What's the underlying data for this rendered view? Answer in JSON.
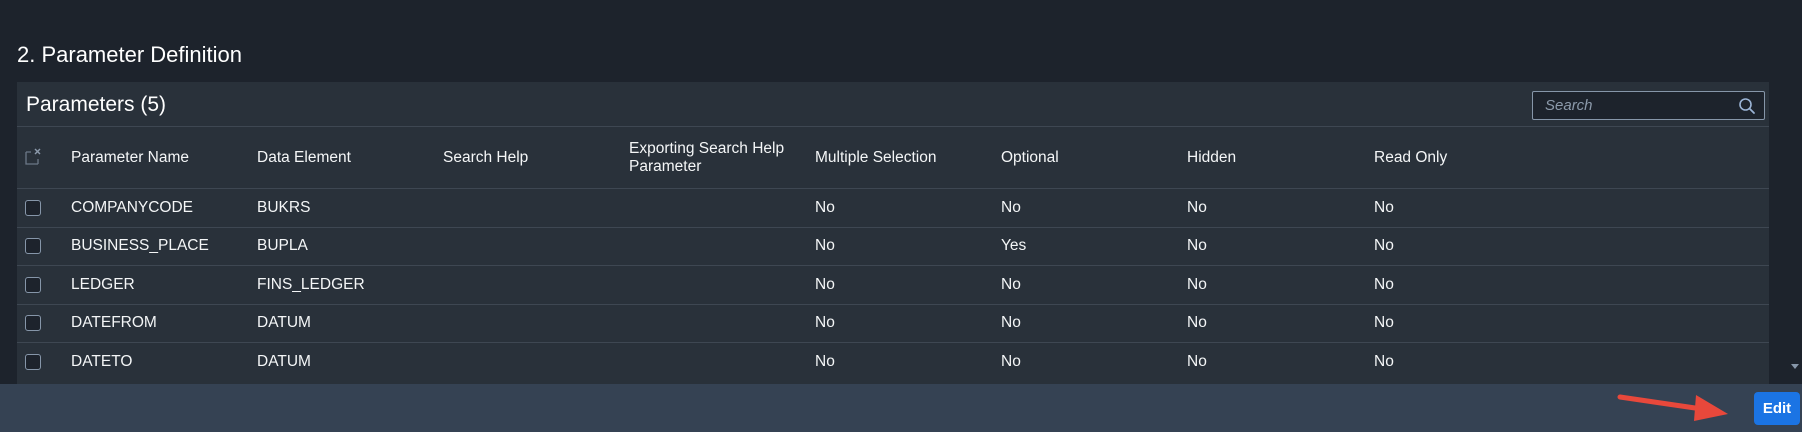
{
  "section": {
    "title": "2. Parameter Definition"
  },
  "panel": {
    "title": "Parameters (5)",
    "search": {
      "placeholder": "Search",
      "value": ""
    }
  },
  "table": {
    "columns": [
      "Parameter Name",
      "Data Element",
      "Search Help",
      "Exporting Search Help Parameter",
      "Multiple Selection",
      "Optional",
      "Hidden",
      "Read Only"
    ],
    "rows": [
      [
        "COMPANYCODE",
        "BUKRS",
        "",
        "",
        "No",
        "No",
        "No",
        "No"
      ],
      [
        "BUSINESS_PLACE",
        "BUPLA",
        "",
        "",
        "No",
        "Yes",
        "No",
        "No"
      ],
      [
        "LEDGER",
        "FINS_LEDGER",
        "",
        "",
        "No",
        "No",
        "No",
        "No"
      ],
      [
        "DATEFROM",
        "DATUM",
        "",
        "",
        "No",
        "No",
        "No",
        "No"
      ],
      [
        "DATETO",
        "DATUM",
        "",
        "",
        "No",
        "No",
        "No",
        "No"
      ]
    ]
  },
  "footer": {
    "edit_label": "Edit"
  },
  "colors": {
    "accent": "#1b74e4",
    "annotation_arrow": "#e8483b",
    "background": "#1d232c",
    "panel": "#29313a",
    "footer": "#354253"
  },
  "icons": {
    "search": "search-icon",
    "clear_selection": "clear-selection-icon",
    "annotation": "red-arrow-icon"
  }
}
